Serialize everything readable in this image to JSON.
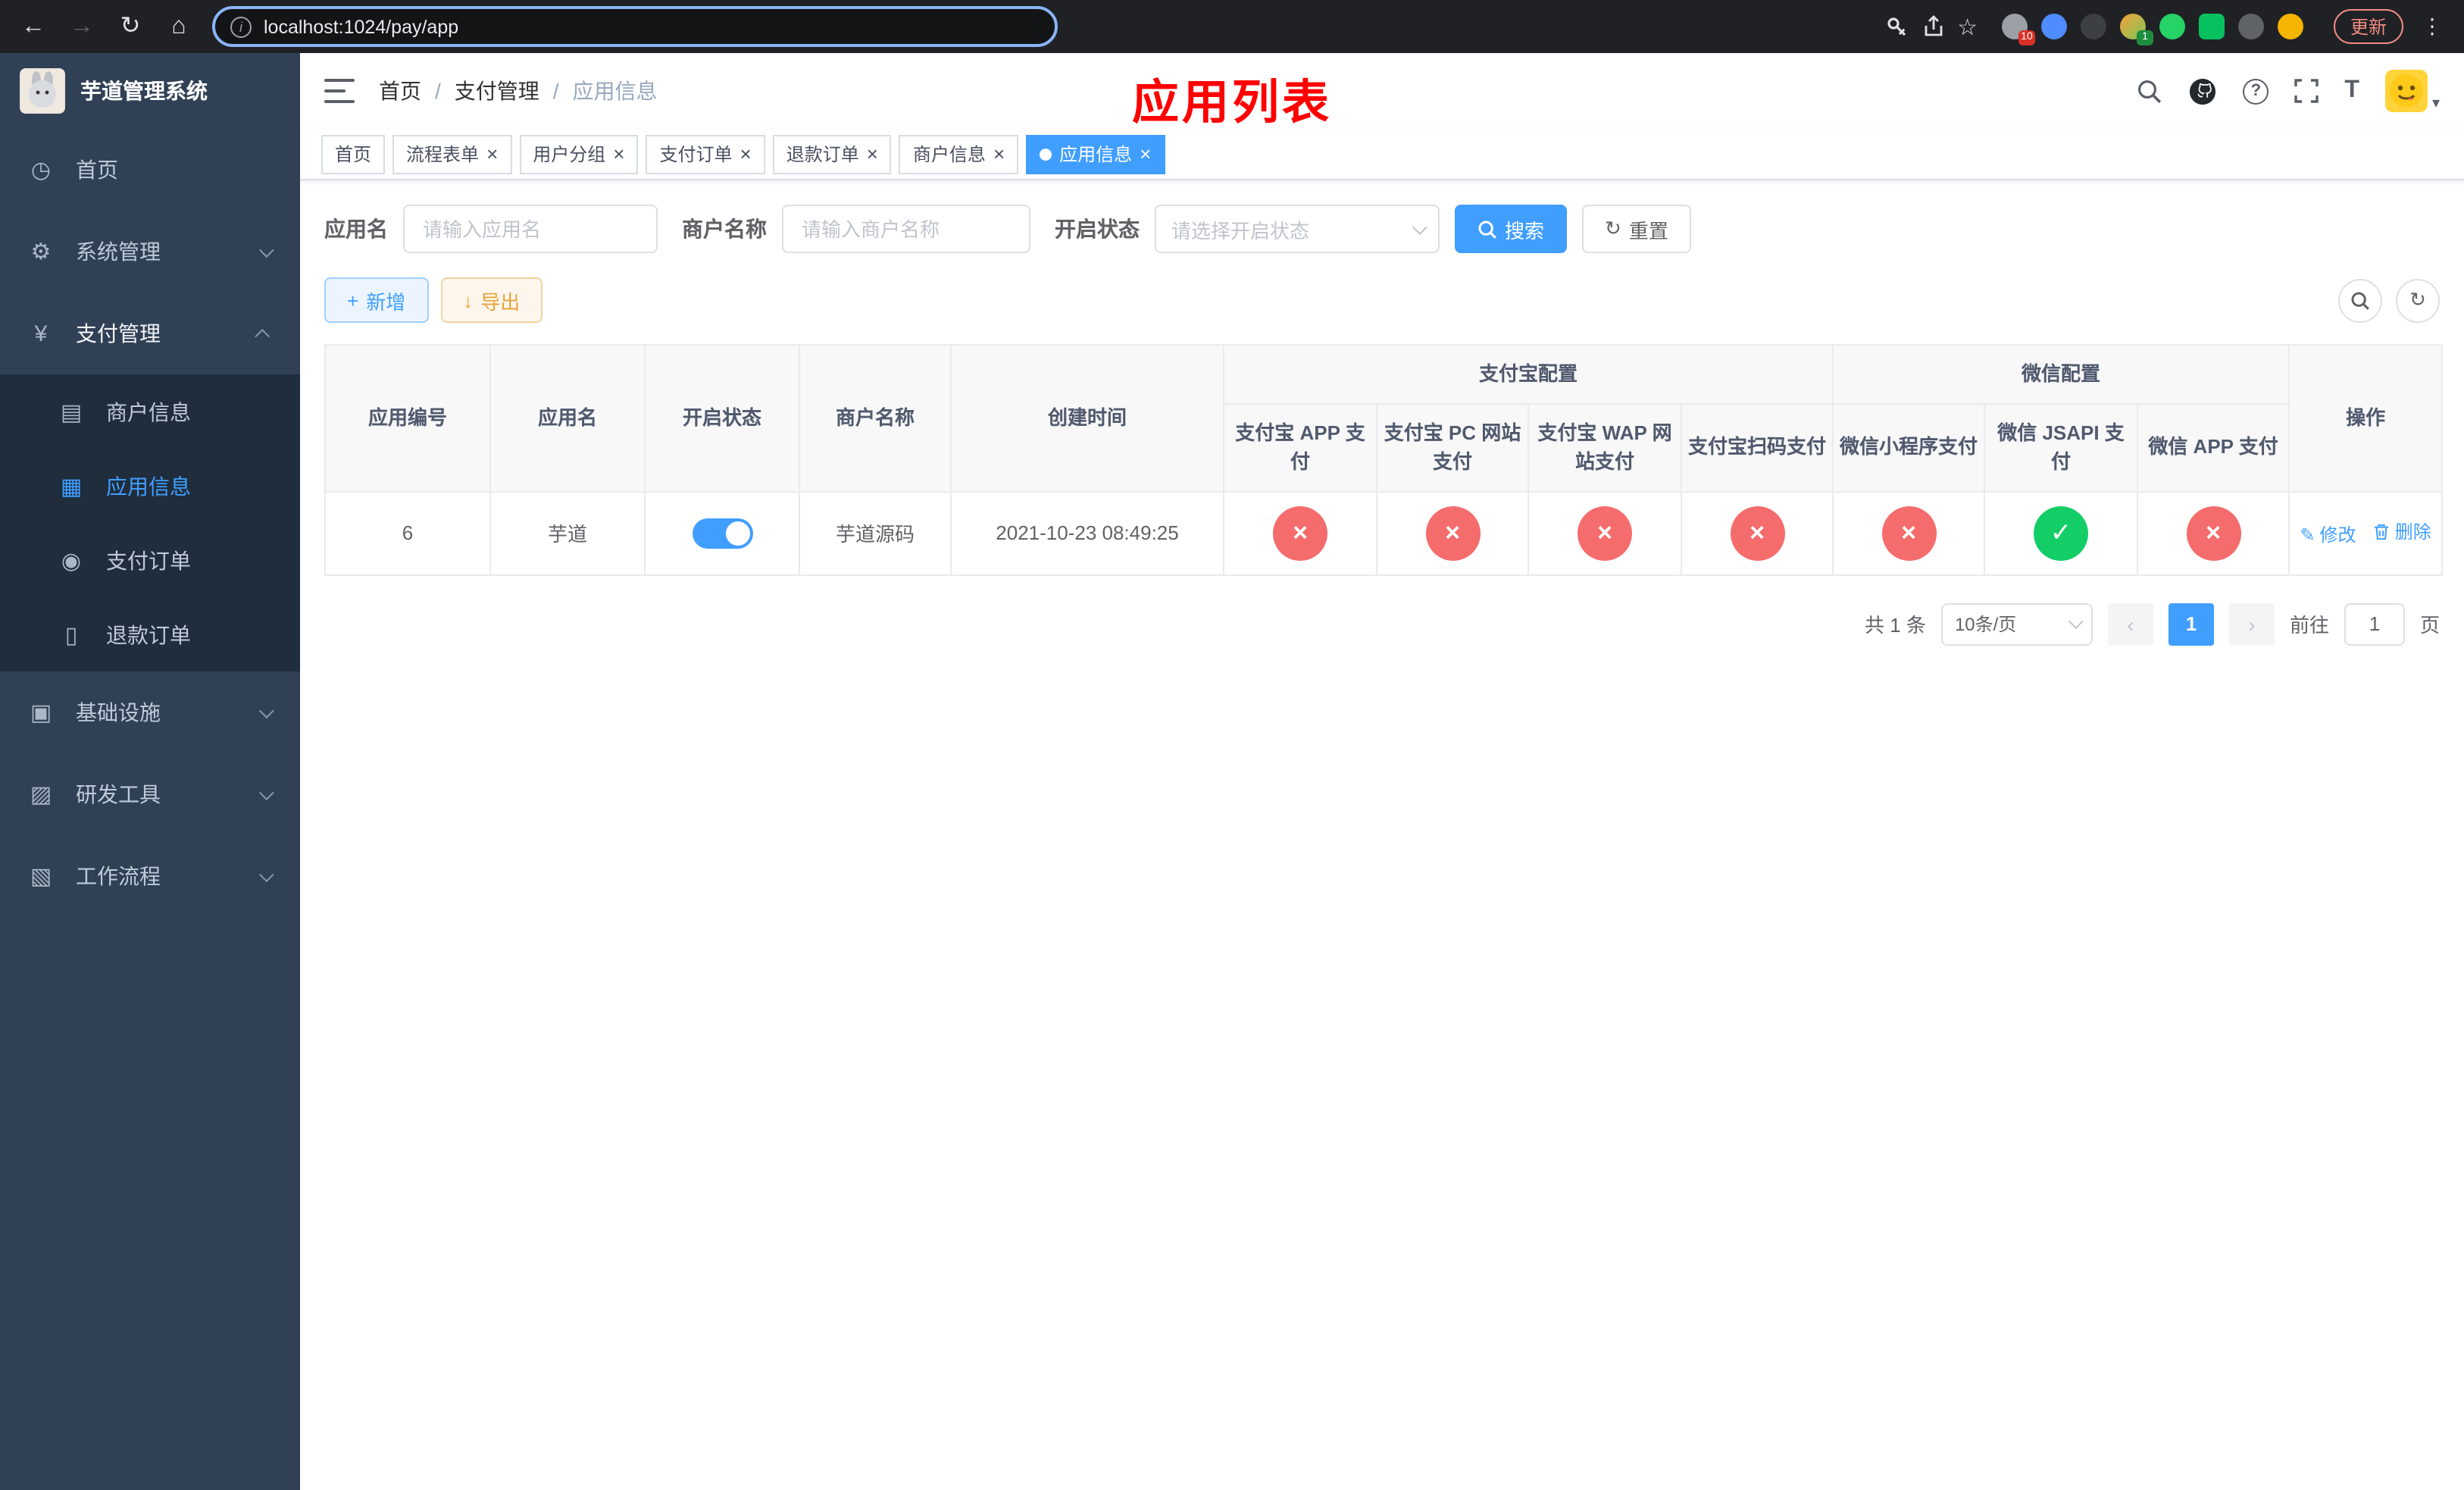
{
  "browser": {
    "url": "localhost:1024/pay/app",
    "update_label": "更新",
    "extension_badge_first": "10",
    "extension_badge_second": "1"
  },
  "icons": {
    "back": "←",
    "forward": "→",
    "reload": "↻",
    "home": "⌂",
    "info": "i",
    "star": "☆",
    "kebab": "⋮",
    "question": "?",
    "text_size": "T",
    "caret_down": "▾",
    "plus": "+",
    "download": "↓",
    "refresh": "↻",
    "edit": "✎",
    "close": "×",
    "check": "✓",
    "prev": "‹",
    "next": "›",
    "menu_home": "◷",
    "menu_system": "⚙",
    "menu_payment": "¥",
    "submenu_merchant": "▤",
    "submenu_app": "▦",
    "submenu_order": "◉",
    "submenu_refund": "▯",
    "menu_infra": "▣",
    "menu_devtools": "▨",
    "menu_workflow": "▧"
  },
  "sidebar": {
    "app_title": "芋道管理系统",
    "menu_home": "首页",
    "menu_system": "系统管理",
    "menu_payment": "支付管理",
    "submenu_merchant": "商户信息",
    "submenu_app": "应用信息",
    "submenu_order": "支付订单",
    "submenu_refund": "退款订单",
    "menu_infra": "基础设施",
    "menu_devtools": "研发工具",
    "menu_workflow": "工作流程"
  },
  "navbar": {
    "breadcrumb_home": "首页",
    "breadcrumb_payment": "支付管理",
    "breadcrumb_current": "应用信息",
    "breadcrumb_separator": "/",
    "page_title": "应用列表"
  },
  "tabs": [
    {
      "label": "首页"
    },
    {
      "label": "流程表单"
    },
    {
      "label": "用户分组"
    },
    {
      "label": "支付订单"
    },
    {
      "label": "退款订单"
    },
    {
      "label": "商户信息"
    },
    {
      "label": "应用信息"
    }
  ],
  "filters": {
    "app_name": {
      "label": "应用名",
      "placeholder": "请输入应用名"
    },
    "merchant_name": {
      "label": "商户名称",
      "placeholder": "请输入商户名称"
    },
    "status": {
      "label": "开启状态",
      "placeholder": "请选择开启状态"
    },
    "search_button": "搜索",
    "reset_button": "重置"
  },
  "toolbar": {
    "add_button": "新增",
    "export_button": "导出"
  },
  "table": {
    "group_headers": {
      "alipay": "支付宝配置",
      "wechat": "微信配置"
    },
    "headers": {
      "app_id": "应用编号",
      "app_name": "应用名",
      "status": "开启状态",
      "merchant_name": "商户名称",
      "created_at": "创建时间",
      "alipay_app": "支付宝 APP 支付",
      "alipay_pc": "支付宝 PC 网站支付",
      "alipay_wap": "支付宝 WAP 网站支付",
      "alipay_qr": "支付宝扫码支付",
      "wechat_mini": "微信小程序支付",
      "wechat_jsapi": "微信 JSAPI 支付",
      "wechat_app": "微信 APP 支付",
      "actions": "操作"
    },
    "rows": [
      {
        "app_id": "6",
        "app_name": "芋道",
        "status_enabled": true,
        "merchant_name": "芋道源码",
        "created_at": "2021-10-23 08:49:25",
        "alipay_app": "disabled",
        "alipay_pc": "disabled",
        "alipay_wap": "disabled",
        "alipay_qr": "disabled",
        "wechat_mini": "disabled",
        "wechat_jsapi": "enabled",
        "wechat_app": "disabled",
        "edit_label": "修改",
        "delete_label": "删除"
      }
    ]
  },
  "pagination": {
    "total_text": "共 1 条",
    "page_size": "10条/页",
    "current_page": "1",
    "goto_prefix": "前往",
    "goto_value": "1",
    "goto_suffix": "页"
  },
  "colors": {
    "primary": "#409eff",
    "danger": "#f56c6c",
    "success": "#13ce66",
    "title_red": "#ff0000",
    "sidebar_bg": "#304156",
    "submenu_bg": "#1f2d3d"
  }
}
